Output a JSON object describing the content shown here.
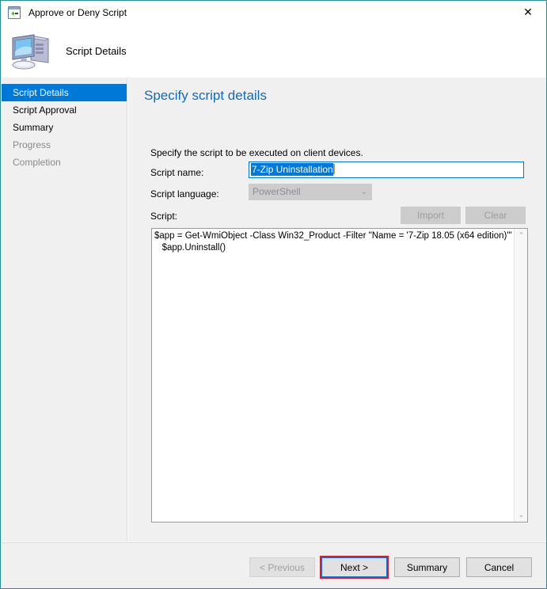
{
  "window": {
    "title": "Approve or Deny Script",
    "icon": "script-window-icon",
    "close_label": "✕",
    "border_color": "#2e8b94"
  },
  "header": {
    "title": "Script Details",
    "icon": "computer-monitor-icon"
  },
  "sidebar": {
    "items": [
      {
        "label": "Script Details",
        "state": "selected"
      },
      {
        "label": "Script Approval",
        "state": "enabled"
      },
      {
        "label": "Summary",
        "state": "enabled"
      },
      {
        "label": "Progress",
        "state": "disabled"
      },
      {
        "label": "Completion",
        "state": "disabled"
      }
    ]
  },
  "content": {
    "heading": "Specify script details",
    "heading_color": "#0f6cbd",
    "intro": "Specify the script to be executed on client devices.",
    "fields": {
      "script_name": {
        "label": "Script name:",
        "value": "7-Zip Uninstallation",
        "selected": true
      },
      "script_language": {
        "label": "Script language:",
        "value": "PowerShell",
        "options": [
          "PowerShell"
        ],
        "disabled": true,
        "chevron": "⌄"
      },
      "script": {
        "label": "Script:",
        "value": "$app = Get-WmiObject -Class Win32_Product -Filter \"Name = '7-Zip 18.05 (x64 edition)'\"\n   $app.Uninstall()"
      }
    },
    "toolbar": {
      "import_label": "Import",
      "clear_label": "Clear",
      "import_disabled": true,
      "clear_disabled": true
    },
    "scrollbar": {
      "up_arrow": "⌃",
      "down_arrow": "⌄"
    }
  },
  "footer": {
    "previous_label": "< Previous",
    "next_label": "Next >",
    "summary_label": "Summary",
    "cancel_label": "Cancel",
    "previous_disabled": true,
    "next_highlight_color": "#e01b24",
    "next_focus_color": "#0078d7"
  }
}
